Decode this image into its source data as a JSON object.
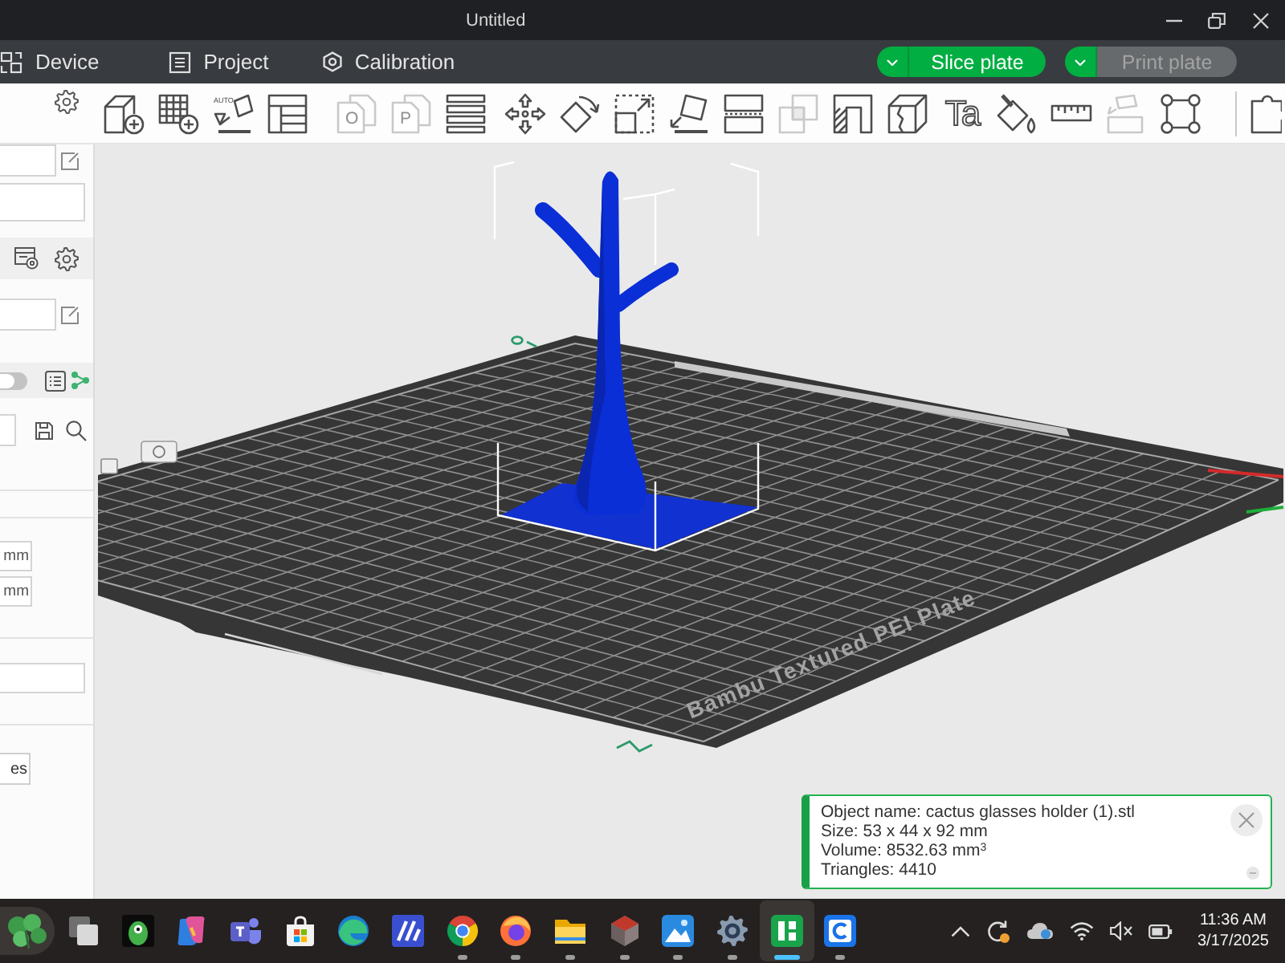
{
  "window": {
    "title": "Untitled"
  },
  "menu_bar": {
    "tabs": [
      {
        "kind": "device",
        "label": "Device",
        "selected": false
      },
      {
        "kind": "project",
        "label": "Project",
        "selected": false
      },
      {
        "kind": "calibration",
        "label": "Calibration",
        "selected": false
      }
    ],
    "actions": [
      {
        "label": "Slice plate",
        "disabled": false
      },
      {
        "label": "Print plate",
        "disabled": true
      }
    ]
  },
  "toolbar": {
    "groups": [
      {
        "tools": [
          {
            "kind": "cube-plus",
            "disabled": false
          },
          {
            "kind": "grid-plus",
            "disabled": false
          },
          {
            "kind": "tilted-square",
            "label": "AUTO",
            "disabled": false
          },
          {
            "kind": "layout",
            "disabled": false
          }
        ]
      },
      {
        "tools": [
          {
            "kind": "pages",
            "label": "O",
            "disabled": true
          },
          {
            "kind": "pages",
            "label": "P",
            "disabled": true
          },
          {
            "kind": "bars",
            "disabled": false
          }
        ]
      },
      {
        "tools": [
          {
            "kind": "four-arrows",
            "disabled": false
          },
          {
            "kind": "rotate",
            "disabled": false
          },
          {
            "kind": "scale",
            "disabled": false
          },
          {
            "kind": "lay-flat",
            "disabled": false
          },
          {
            "kind": "split",
            "disabled": false
          },
          {
            "kind": "overlap",
            "disabled": true
          },
          {
            "kind": "hatched-corner",
            "disabled": false
          },
          {
            "kind": "cracked-cube",
            "disabled": false
          },
          {
            "kind": "glyph",
            "label": "Ta",
            "disabled": false
          },
          {
            "kind": "bucket",
            "disabled": false
          },
          {
            "kind": "ruler",
            "disabled": false
          },
          {
            "kind": "stacked-blocks",
            "disabled": true
          },
          {
            "kind": "frame-corners",
            "disabled": false
          }
        ]
      },
      {
        "tools": [
          {
            "kind": "puzzle",
            "disabled": false
          }
        ]
      }
    ]
  },
  "sidebar": {
    "rows": [
      {
        "kind": "field-edit"
      },
      {
        "kind": "field"
      },
      {
        "kind": "bar"
      },
      {
        "kind": "field-edit"
      },
      {
        "kind": "toggle-bar",
        "on": false
      },
      {
        "kind": "field-search"
      },
      {
        "kind": "divider"
      },
      {
        "kind": "divider"
      },
      {
        "kind": "unit-field",
        "text": "mm"
      },
      {
        "kind": "unit-field",
        "text": "mm"
      },
      {
        "kind": "divider"
      },
      {
        "kind": "field"
      },
      {
        "kind": "divider"
      },
      {
        "kind": "button",
        "text": "es"
      }
    ]
  },
  "viewport": {
    "plate_label": "Bambu Textured PEI Plate",
    "notification": {
      "lines": [
        "Object name: cactus glasses holder (1).stl",
        "Size: 53 x 44 x 92 mm",
        "Volume: 8532.63 mm$^{3}$",
        "Triangles: 4410"
      ]
    }
  },
  "taskbar": {
    "apps": [
      {
        "kind": "widget",
        "running": false,
        "selected": false
      },
      {
        "kind": "task-view",
        "running": false,
        "selected": false
      },
      {
        "kind": "creature",
        "running": false,
        "selected": false
      },
      {
        "kind": "ribbon",
        "running": false,
        "selected": false
      },
      {
        "kind": "people",
        "running": false,
        "selected": false
      },
      {
        "kind": "bag",
        "running": false,
        "selected": false
      },
      {
        "kind": "swirl",
        "running": false,
        "selected": false
      },
      {
        "kind": "stripes",
        "running": false,
        "selected": false
      },
      {
        "kind": "pinwheel",
        "running": true,
        "selected": false
      },
      {
        "kind": "flame",
        "running": true,
        "selected": false
      },
      {
        "kind": "folder",
        "running": true,
        "selected": false
      },
      {
        "kind": "gem",
        "running": true,
        "selected": false
      },
      {
        "kind": "mountains",
        "running": true,
        "selected": false
      },
      {
        "kind": "gear",
        "running": true,
        "selected": false
      },
      {
        "kind": "bars",
        "running": true,
        "selected": true
      },
      {
        "kind": "arc",
        "running": true,
        "selected": false
      }
    ],
    "clock": {
      "time": "11:36 AM",
      "date": "3/17/2025"
    }
  }
}
